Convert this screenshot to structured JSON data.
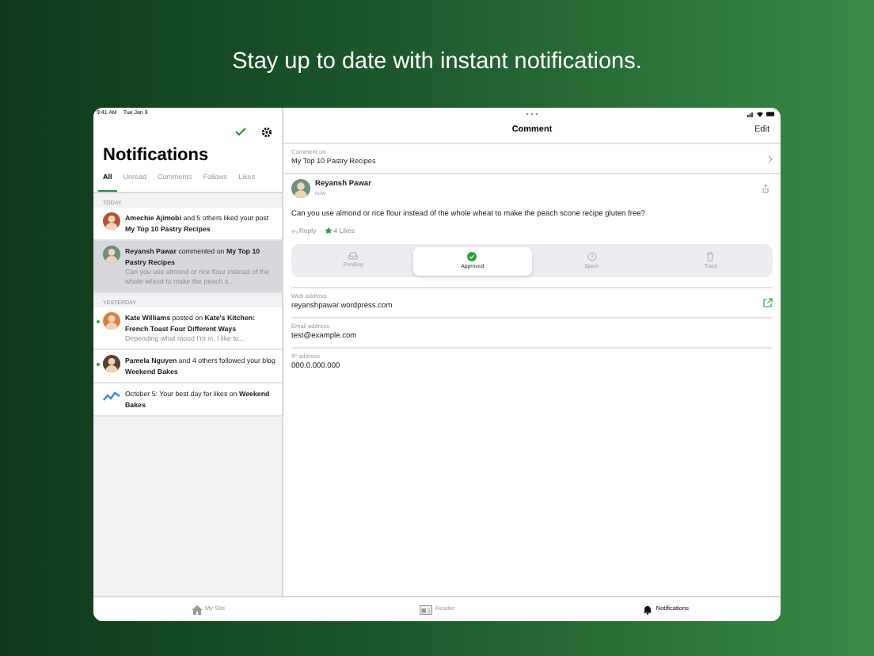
{
  "headline": "Stay up to date with instant notifications.",
  "status_bar": {
    "time": "9:41 AM",
    "date": "Tue Jan 9"
  },
  "sidebar": {
    "title": "Notifications",
    "filters": [
      {
        "label": "All",
        "selected": true
      },
      {
        "label": "Unread",
        "selected": false
      },
      {
        "label": "Comments",
        "selected": false
      },
      {
        "label": "Follows",
        "selected": false
      },
      {
        "label": "Likes",
        "selected": false
      }
    ],
    "sections": [
      {
        "heading": "TODAY",
        "items": [
          {
            "kind": "avatar",
            "color": "#b5523a",
            "unread": false,
            "selected": false,
            "text": "**Amechie Ajimobi** and 5 others liked your post **My Top 10 Pastry Recipes**"
          },
          {
            "kind": "avatar",
            "color": "#6b8f7a",
            "unread": false,
            "selected": true,
            "text": "**Reyansh Pawar** commented on **My Top 10 Pastry Recipes**",
            "excerpt": "Can you use almond or rice flour instead of the whole wheat to make the peach s..."
          }
        ]
      },
      {
        "heading": "YESTERDAY",
        "items": [
          {
            "kind": "avatar",
            "color": "#d9803a",
            "unread": true,
            "selected": false,
            "text": "**Kate Williams** posted on **Kate's Kitchen: French Toast Four Different Ways**",
            "excerpt": "Depending what mood I'm in, I like to..."
          },
          {
            "kind": "avatar",
            "color": "#5a4030",
            "unread": true,
            "selected": false,
            "text": "**Pamela Nguyen** and 4 others followed your blog **Weekend Bakes**"
          },
          {
            "kind": "stats",
            "color": "#3b8fd1",
            "unread": false,
            "selected": false,
            "text": "October 5: Your best day for likes on **Weekend Bakes**"
          }
        ]
      }
    ]
  },
  "detail": {
    "title": "Comment",
    "edit": "Edit",
    "comment_on": {
      "label": "Comment on",
      "value": "My Top 10 Pastry Recipes"
    },
    "author": {
      "name": "Reyansh Pawar",
      "time": "now"
    },
    "body": "Can you use almond or rice flour instead of the whole wheat to make the peach scone recipe gluten free?",
    "reply": "Reply",
    "likes": "4 Likes",
    "moderation": [
      {
        "kind": "pending",
        "label": "Pending",
        "selected": false
      },
      {
        "kind": "approved",
        "label": "Approved",
        "selected": true
      },
      {
        "kind": "spam",
        "label": "Spam",
        "selected": false
      },
      {
        "kind": "trash",
        "label": "Trash",
        "selected": false
      }
    ],
    "fields": [
      {
        "label": "Web address",
        "value": "reyanshpawar.wordpress.com",
        "kind": "link"
      },
      {
        "label": "Email address",
        "value": "test@example.com",
        "kind": "text"
      },
      {
        "label": "IP address",
        "value": "000.0.000.000",
        "kind": "text"
      }
    ]
  },
  "tab_bar": [
    {
      "kind": "home",
      "label": "My Site",
      "selected": false
    },
    {
      "kind": "reader",
      "label": "Reader",
      "selected": false
    },
    {
      "kind": "bell",
      "label": "Notifications",
      "selected": true
    }
  ]
}
